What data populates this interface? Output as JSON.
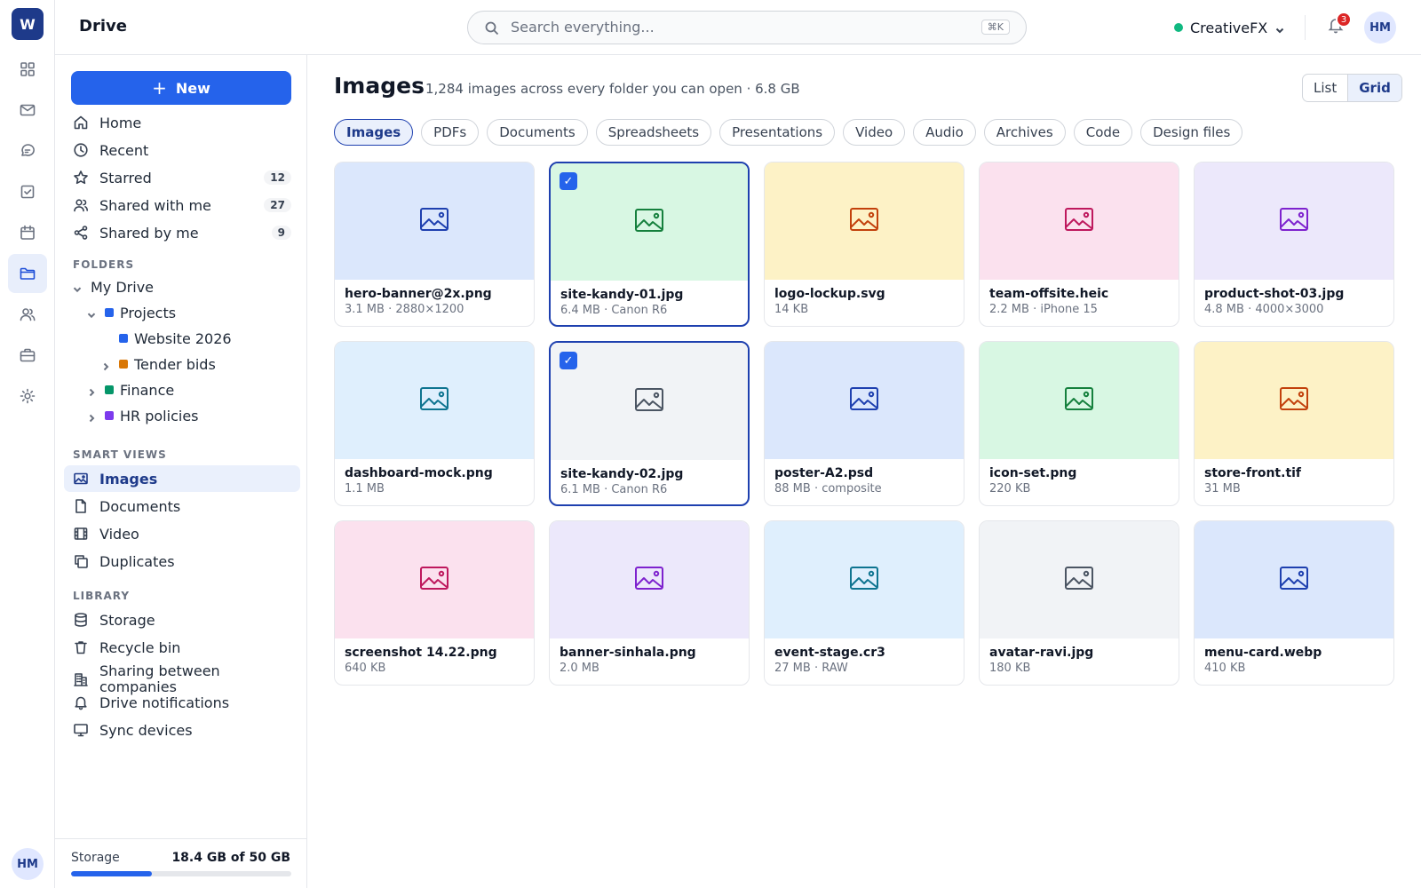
{
  "rail": {
    "logo": "W",
    "icons": [
      "grid-icon",
      "mail-icon",
      "chat-icon",
      "tasks-icon",
      "calendar-icon",
      "folder-icon",
      "people-icon",
      "briefcase-icon",
      "settings-icon"
    ],
    "active": "folder-icon",
    "avatar": "HM"
  },
  "topbar": {
    "title": "Drive",
    "search_placeholder": "Search everything...",
    "search_shortcut": "⌘K",
    "workspace": "CreativeFX",
    "workspace_color": "#10b981",
    "notifications_count": "3",
    "avatar": "HM"
  },
  "sidebar": {
    "new_label": "New",
    "nav": [
      {
        "label": "Home",
        "icon": "home-icon",
        "count": ""
      },
      {
        "label": "Recent",
        "icon": "clock-icon",
        "count": ""
      },
      {
        "label": "Starred",
        "icon": "star-icon",
        "count": "12"
      },
      {
        "label": "Shared with me",
        "icon": "users-icon",
        "count": "27"
      },
      {
        "label": "Shared by me",
        "icon": "share-icon",
        "count": "9"
      }
    ],
    "folders_label": "FOLDERS",
    "tree": [
      {
        "label": "My Drive",
        "color": "",
        "expanded": true
      },
      {
        "label": "Projects",
        "color": "#2563eb",
        "expanded": true
      },
      {
        "label": "Website 2026",
        "color": "#2563eb",
        "expanded": false
      },
      {
        "label": "Tender bids",
        "color": "#d97706",
        "expanded": false
      },
      {
        "label": "Finance",
        "color": "#059669",
        "expanded": false
      },
      {
        "label": "HR policies",
        "color": "#7c3aed",
        "expanded": false
      }
    ],
    "smart_label": "SMART VIEWS",
    "smart": [
      {
        "label": "Images",
        "icon": "image-icon",
        "active": true
      },
      {
        "label": "Documents",
        "icon": "document-icon",
        "active": false
      },
      {
        "label": "Video",
        "icon": "film-icon",
        "active": false
      },
      {
        "label": "Duplicates",
        "icon": "copy-icon",
        "active": false
      }
    ],
    "library_label": "LIBRARY",
    "library": [
      {
        "label": "Storage",
        "icon": "database-icon"
      },
      {
        "label": "Recycle bin",
        "icon": "trash-icon"
      },
      {
        "label": "Sharing between companies",
        "icon": "building-icon"
      },
      {
        "label": "Drive notifications",
        "icon": "bell-icon"
      },
      {
        "label": "Sync devices",
        "icon": "monitor-icon"
      }
    ],
    "storage": {
      "label": "Storage",
      "value": "18.4 GB of 50 GB",
      "fraction": 0.368
    }
  },
  "main": {
    "title": "Images",
    "subtitle": "1,284 images across every folder you can open · 6.8 GB",
    "view_list": "List",
    "view_grid": "Grid",
    "filters": [
      "Images",
      "PDFs",
      "Documents",
      "Spreadsheets",
      "Presentations",
      "Video",
      "Audio",
      "Archives",
      "Code",
      "Design files"
    ],
    "active_filter": "Images",
    "files": [
      {
        "name": "hero-banner@2x.png",
        "meta": "3.1 MB · 2880×1200",
        "bg": "#dbe7fc",
        "stroke": "#1e40af",
        "selected": false
      },
      {
        "name": "site-kandy-01.jpg",
        "meta": "6.4 MB · Canon R6",
        "bg": "#d8f7e3",
        "stroke": "#15803d",
        "selected": true
      },
      {
        "name": "logo-lockup.svg",
        "meta": "14 KB",
        "bg": "#fdf2c6",
        "stroke": "#c2410c",
        "selected": false
      },
      {
        "name": "team-offsite.heic",
        "meta": "2.2 MB · iPhone 15",
        "bg": "#fbe1ee",
        "stroke": "#be185d",
        "selected": false
      },
      {
        "name": "product-shot-03.jpg",
        "meta": "4.8 MB · 4000×3000",
        "bg": "#ece8fb",
        "stroke": "#7e22ce",
        "selected": false
      },
      {
        "name": "dashboard-mock.png",
        "meta": "1.1 MB",
        "bg": "#dfeffd",
        "stroke": "#0e7490",
        "selected": false
      },
      {
        "name": "site-kandy-02.jpg",
        "meta": "6.1 MB · Canon R6",
        "bg": "#f1f3f6",
        "stroke": "#4b5563",
        "selected": true
      },
      {
        "name": "poster-A2.psd",
        "meta": "88 MB · composite",
        "bg": "#dbe7fc",
        "stroke": "#1e40af",
        "selected": false
      },
      {
        "name": "icon-set.png",
        "meta": "220 KB",
        "bg": "#d8f7e3",
        "stroke": "#15803d",
        "selected": false
      },
      {
        "name": "store-front.tif",
        "meta": "31 MB",
        "bg": "#fdf2c6",
        "stroke": "#c2410c",
        "selected": false
      },
      {
        "name": "screenshot 14.22.png",
        "meta": "640 KB",
        "bg": "#fbe1ee",
        "stroke": "#be185d",
        "selected": false
      },
      {
        "name": "banner-sinhala.png",
        "meta": "2.0 MB",
        "bg": "#ece8fb",
        "stroke": "#7e22ce",
        "selected": false
      },
      {
        "name": "event-stage.cr3",
        "meta": "27 MB · RAW",
        "bg": "#dfeffd",
        "stroke": "#0e7490",
        "selected": false
      },
      {
        "name": "avatar-ravi.jpg",
        "meta": "180 KB",
        "bg": "#f1f3f6",
        "stroke": "#4b5563",
        "selected": false
      },
      {
        "name": "menu-card.webp",
        "meta": "410 KB",
        "bg": "#dbe7fc",
        "stroke": "#1e40af",
        "selected": false
      }
    ]
  }
}
